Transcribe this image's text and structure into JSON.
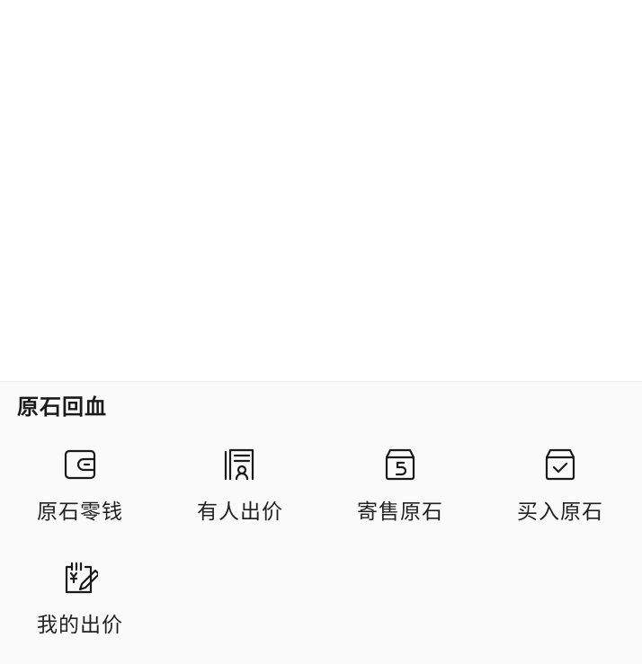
{
  "section": {
    "title": "原石回血"
  },
  "items": [
    {
      "label": "原石零钱",
      "icon": "wallet-icon"
    },
    {
      "label": "有人出价",
      "icon": "offer-document-icon"
    },
    {
      "label": "寄售原石",
      "icon": "return-box-icon"
    },
    {
      "label": "买入原石",
      "icon": "check-box-icon"
    },
    {
      "label": "我的出价",
      "icon": "edit-notepad-icon"
    }
  ]
}
